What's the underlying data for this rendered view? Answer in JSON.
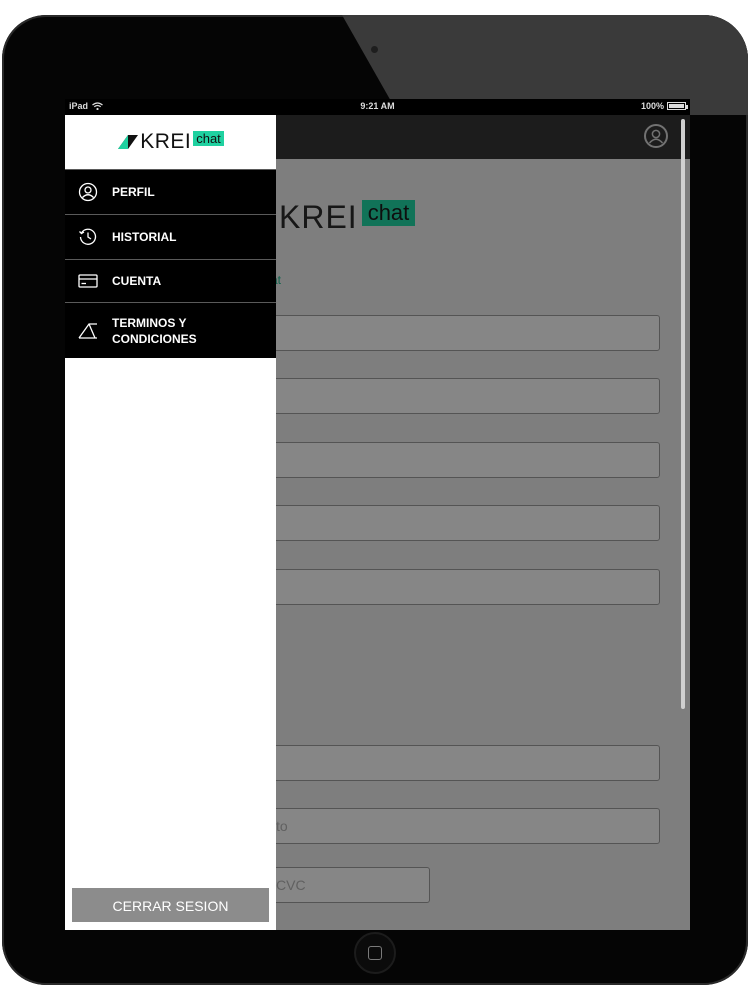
{
  "status_bar": {
    "device": "iPad",
    "time": "9:21 AM",
    "battery": "100%"
  },
  "brand": {
    "word": "KREI",
    "bubble": "chat"
  },
  "app": {
    "link_fragment": "at",
    "amount_placeholder_fragment": "to",
    "cvc_label": "VC",
    "cvc_placeholder": "CVC"
  },
  "drawer": {
    "menu": [
      {
        "label": "PERFIL",
        "icon": "user-circle-icon"
      },
      {
        "label": "HISTORIAL",
        "icon": "history-icon"
      },
      {
        "label": "CUENTA",
        "icon": "credit-card-icon"
      },
      {
        "label": "TERMINOS Y\nCONDICIONES",
        "icon": "terms-icon"
      }
    ],
    "logout_label": "CERRAR SESION"
  },
  "colors": {
    "brand_accent": "#1fd1a0",
    "menu_background": "#000000",
    "logout_button": "#8c8c8c"
  }
}
